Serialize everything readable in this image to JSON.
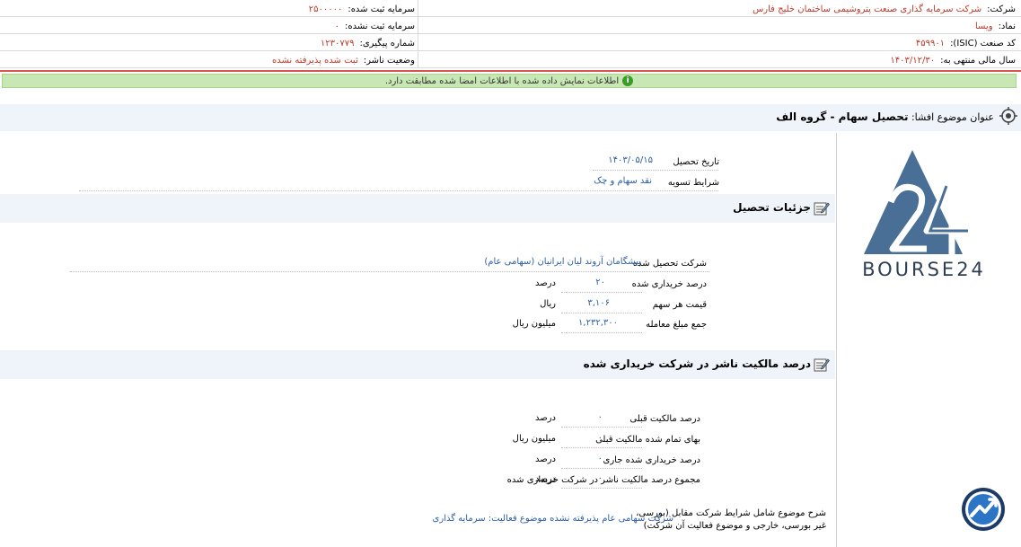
{
  "header": {
    "company_label": "شرکت:",
    "company_value": "شرکت سرمایه گذاری صنعت پتروشیمی ساختمان خلیج فارس",
    "symbol_label": "نماد:",
    "symbol_value": "ویسا",
    "isic_label": "کد صنعت (ISIC):",
    "isic_value": "۴۵۹۹۰۱",
    "fiscal_label": "سال مالی منتهی به:",
    "fiscal_value": "۱۴۰۳/۱۲/۳۰",
    "reg_capital_label": "سرمایه ثبت شده:",
    "reg_capital_value": "۲۵۰۰۰۰۰",
    "unreg_capital_label": "سرمایه ثبت نشده:",
    "unreg_capital_value": "۰",
    "tracking_label": "شماره پیگیری:",
    "tracking_value": "۱۲۳۰۷۷۹",
    "publisher_status_label": "وضعیت ناشر:",
    "publisher_status_value": "ثبت شده پذیرفته نشده"
  },
  "notice": {
    "icon": "info-icon",
    "text": "اطلاعات نمایش داده شده با اطلاعات امضا شده مطابقت دارد."
  },
  "topic": {
    "label": "عنوان موضوع افشا:",
    "value": "تحصیل سهام - گروه الف"
  },
  "general": {
    "acq_date_label": "تاریخ تحصیل",
    "acq_date_value": "۱۴۰۳/۰۵/۱۵",
    "settlement_label": "شرایط تسویه",
    "settlement_value": "نقد سهام و چک"
  },
  "details": {
    "title": "جزئیات تحصیل",
    "company_label": "شرکت تحصیل شده",
    "company_value": "پیشگامان آروند لیان ایرانیان (سهامی عام)",
    "purchase_pct_label": "درصد خریداری شده",
    "purchase_pct_value": "۲۰",
    "purchase_pct_unit": "درصد",
    "share_price_label": "قیمت هر سهم",
    "share_price_value": "۳,۱۰۶",
    "share_price_unit": "ریال",
    "total_label": "جمع مبلغ معامله",
    "total_value": "۱,۲۳۲,۳۰۰",
    "total_unit": "میلیون ریال"
  },
  "ownership": {
    "title": "درصد مالکیت ناشر در شرکت خریداری شده",
    "prev_pct_label": "درصد مالکیت قبلی",
    "prev_pct_value": "۰",
    "prev_pct_unit": "درصد",
    "prev_cost_label": "بهای تمام شده مالکیت قبلی",
    "prev_cost_value": "۰",
    "prev_cost_unit": "میلیون ریال",
    "curr_pct_label": "درصد خریداری شده جاری",
    "curr_pct_value": "۰",
    "curr_pct_unit": "درصد",
    "total_pct_label": "مجموع درصد مالکیت ناشر در شرکت خریداری شده",
    "total_pct_value": "۰",
    "total_pct_unit": "درصد"
  },
  "description": {
    "label_line1": "شرح موضوع شامل شرایط شرکت مقابل (بورسی،",
    "label_line2": "غیر بورسی، خارجی و موضوع فعالیت آن شرکت)",
    "value": "شرکت سهامی عام پذیرفته نشده موضوع فعالیت: سرمایه گذاری"
  },
  "logo": {
    "text": "BOURSE24",
    "color": "#4a6f96"
  }
}
